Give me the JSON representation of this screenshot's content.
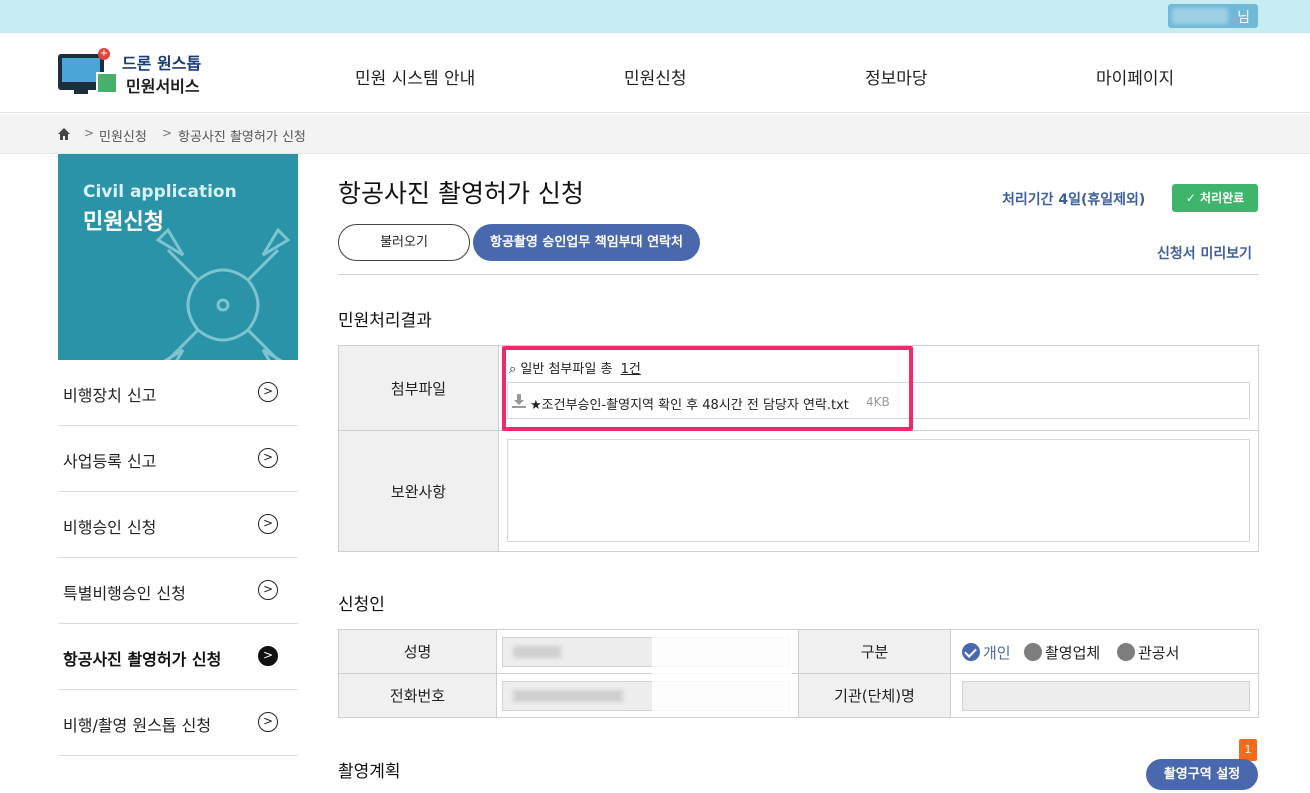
{
  "user": {
    "suffix": "님"
  },
  "logo": {
    "line1": "드론 원스톱",
    "line2": "민원서비스"
  },
  "nav": [
    {
      "label": "민원 시스템 안내"
    },
    {
      "label": "민원신청"
    },
    {
      "label": "정보마당"
    },
    {
      "label": "마이페이지"
    }
  ],
  "breadcrumb": {
    "separator": ">",
    "items": [
      "민원신청",
      "항공사진 촬영허가 신청"
    ]
  },
  "sidebar": {
    "banner_en": "Civil application",
    "banner_ko": "민원신청",
    "items": [
      {
        "label": "비행장치 신고",
        "active": false
      },
      {
        "label": "사업등록 신고",
        "active": false
      },
      {
        "label": "비행승인 신청",
        "active": false
      },
      {
        "label": "특별비행승인 신청",
        "active": false
      },
      {
        "label": "항공사진 촬영허가 신청",
        "active": true
      },
      {
        "label": "비행/촬영 원스톱 신청",
        "active": false
      }
    ],
    "arrow": ">"
  },
  "main": {
    "title": "항공사진 촬영허가 신청",
    "period": "처리기간 4일(휴일제외)",
    "status_badge": "처리완료",
    "status_icon": "✓",
    "btn_load": "불러오기",
    "btn_contact": "항공촬영 승인업무 책임부대 연락처",
    "preview_link": "신청서 미리보기"
  },
  "result_section": {
    "title": "민원처리결과",
    "attach_label": "첨부파일",
    "attach_head": "일반 첨부파일 총",
    "attach_count": "1건",
    "file_name": "★조건부승인-촬영지역 확인 후 48시간 전 담당자 연락.txt",
    "file_size": "4KB",
    "memo_label": "보완사항"
  },
  "applicant_section": {
    "title": "신청인",
    "name_label": "성명",
    "phone_label": "전화번호",
    "type_label": "구분",
    "org_label": "기관(단체)명",
    "types": [
      {
        "label": "개인",
        "checked": true
      },
      {
        "label": "촬영업체",
        "checked": false
      },
      {
        "label": "관공서",
        "checked": false
      }
    ]
  },
  "plan_section": {
    "title": "촬영계획",
    "zone_button": "촬영구역 설정",
    "zone_count": "1"
  },
  "colors": {
    "accent": "#4a68ad",
    "teal": "#2a93a7",
    "success": "#3eb56a",
    "highlight": "#f1286c",
    "badge": "#f56a1c"
  }
}
